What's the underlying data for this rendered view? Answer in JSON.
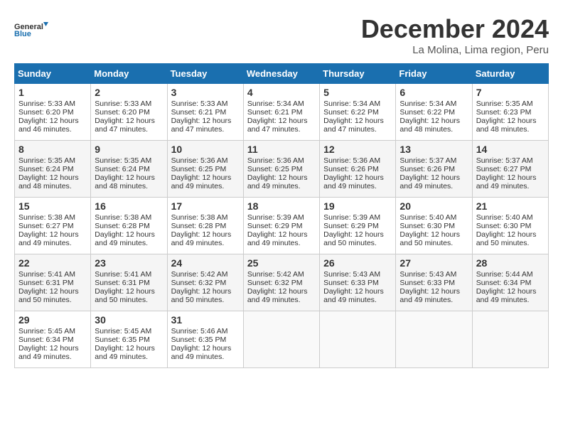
{
  "logo": {
    "line1": "General",
    "line2": "Blue"
  },
  "title": "December 2024",
  "subtitle": "La Molina, Lima region, Peru",
  "weekdays": [
    "Sunday",
    "Monday",
    "Tuesday",
    "Wednesday",
    "Thursday",
    "Friday",
    "Saturday"
  ],
  "weeks": [
    [
      {
        "day": "1",
        "lines": [
          "Sunrise: 5:33 AM",
          "Sunset: 6:20 PM",
          "Daylight: 12 hours",
          "and 46 minutes."
        ]
      },
      {
        "day": "2",
        "lines": [
          "Sunrise: 5:33 AM",
          "Sunset: 6:20 PM",
          "Daylight: 12 hours",
          "and 47 minutes."
        ]
      },
      {
        "day": "3",
        "lines": [
          "Sunrise: 5:33 AM",
          "Sunset: 6:21 PM",
          "Daylight: 12 hours",
          "and 47 minutes."
        ]
      },
      {
        "day": "4",
        "lines": [
          "Sunrise: 5:34 AM",
          "Sunset: 6:21 PM",
          "Daylight: 12 hours",
          "and 47 minutes."
        ]
      },
      {
        "day": "5",
        "lines": [
          "Sunrise: 5:34 AM",
          "Sunset: 6:22 PM",
          "Daylight: 12 hours",
          "and 47 minutes."
        ]
      },
      {
        "day": "6",
        "lines": [
          "Sunrise: 5:34 AM",
          "Sunset: 6:22 PM",
          "Daylight: 12 hours",
          "and 48 minutes."
        ]
      },
      {
        "day": "7",
        "lines": [
          "Sunrise: 5:35 AM",
          "Sunset: 6:23 PM",
          "Daylight: 12 hours",
          "and 48 minutes."
        ]
      }
    ],
    [
      {
        "day": "8",
        "lines": [
          "Sunrise: 5:35 AM",
          "Sunset: 6:24 PM",
          "Daylight: 12 hours",
          "and 48 minutes."
        ]
      },
      {
        "day": "9",
        "lines": [
          "Sunrise: 5:35 AM",
          "Sunset: 6:24 PM",
          "Daylight: 12 hours",
          "and 48 minutes."
        ]
      },
      {
        "day": "10",
        "lines": [
          "Sunrise: 5:36 AM",
          "Sunset: 6:25 PM",
          "Daylight: 12 hours",
          "and 49 minutes."
        ]
      },
      {
        "day": "11",
        "lines": [
          "Sunrise: 5:36 AM",
          "Sunset: 6:25 PM",
          "Daylight: 12 hours",
          "and 49 minutes."
        ]
      },
      {
        "day": "12",
        "lines": [
          "Sunrise: 5:36 AM",
          "Sunset: 6:26 PM",
          "Daylight: 12 hours",
          "and 49 minutes."
        ]
      },
      {
        "day": "13",
        "lines": [
          "Sunrise: 5:37 AM",
          "Sunset: 6:26 PM",
          "Daylight: 12 hours",
          "and 49 minutes."
        ]
      },
      {
        "day": "14",
        "lines": [
          "Sunrise: 5:37 AM",
          "Sunset: 6:27 PM",
          "Daylight: 12 hours",
          "and 49 minutes."
        ]
      }
    ],
    [
      {
        "day": "15",
        "lines": [
          "Sunrise: 5:38 AM",
          "Sunset: 6:27 PM",
          "Daylight: 12 hours",
          "and 49 minutes."
        ]
      },
      {
        "day": "16",
        "lines": [
          "Sunrise: 5:38 AM",
          "Sunset: 6:28 PM",
          "Daylight: 12 hours",
          "and 49 minutes."
        ]
      },
      {
        "day": "17",
        "lines": [
          "Sunrise: 5:38 AM",
          "Sunset: 6:28 PM",
          "Daylight: 12 hours",
          "and 49 minutes."
        ]
      },
      {
        "day": "18",
        "lines": [
          "Sunrise: 5:39 AM",
          "Sunset: 6:29 PM",
          "Daylight: 12 hours",
          "and 49 minutes."
        ]
      },
      {
        "day": "19",
        "lines": [
          "Sunrise: 5:39 AM",
          "Sunset: 6:29 PM",
          "Daylight: 12 hours",
          "and 50 minutes."
        ]
      },
      {
        "day": "20",
        "lines": [
          "Sunrise: 5:40 AM",
          "Sunset: 6:30 PM",
          "Daylight: 12 hours",
          "and 50 minutes."
        ]
      },
      {
        "day": "21",
        "lines": [
          "Sunrise: 5:40 AM",
          "Sunset: 6:30 PM",
          "Daylight: 12 hours",
          "and 50 minutes."
        ]
      }
    ],
    [
      {
        "day": "22",
        "lines": [
          "Sunrise: 5:41 AM",
          "Sunset: 6:31 PM",
          "Daylight: 12 hours",
          "and 50 minutes."
        ]
      },
      {
        "day": "23",
        "lines": [
          "Sunrise: 5:41 AM",
          "Sunset: 6:31 PM",
          "Daylight: 12 hours",
          "and 50 minutes."
        ]
      },
      {
        "day": "24",
        "lines": [
          "Sunrise: 5:42 AM",
          "Sunset: 6:32 PM",
          "Daylight: 12 hours",
          "and 50 minutes."
        ]
      },
      {
        "day": "25",
        "lines": [
          "Sunrise: 5:42 AM",
          "Sunset: 6:32 PM",
          "Daylight: 12 hours",
          "and 49 minutes."
        ]
      },
      {
        "day": "26",
        "lines": [
          "Sunrise: 5:43 AM",
          "Sunset: 6:33 PM",
          "Daylight: 12 hours",
          "and 49 minutes."
        ]
      },
      {
        "day": "27",
        "lines": [
          "Sunrise: 5:43 AM",
          "Sunset: 6:33 PM",
          "Daylight: 12 hours",
          "and 49 minutes."
        ]
      },
      {
        "day": "28",
        "lines": [
          "Sunrise: 5:44 AM",
          "Sunset: 6:34 PM",
          "Daylight: 12 hours",
          "and 49 minutes."
        ]
      }
    ],
    [
      {
        "day": "29",
        "lines": [
          "Sunrise: 5:45 AM",
          "Sunset: 6:34 PM",
          "Daylight: 12 hours",
          "and 49 minutes."
        ]
      },
      {
        "day": "30",
        "lines": [
          "Sunrise: 5:45 AM",
          "Sunset: 6:35 PM",
          "Daylight: 12 hours",
          "and 49 minutes."
        ]
      },
      {
        "day": "31",
        "lines": [
          "Sunrise: 5:46 AM",
          "Sunset: 6:35 PM",
          "Daylight: 12 hours",
          "and 49 minutes."
        ]
      },
      null,
      null,
      null,
      null
    ]
  ]
}
